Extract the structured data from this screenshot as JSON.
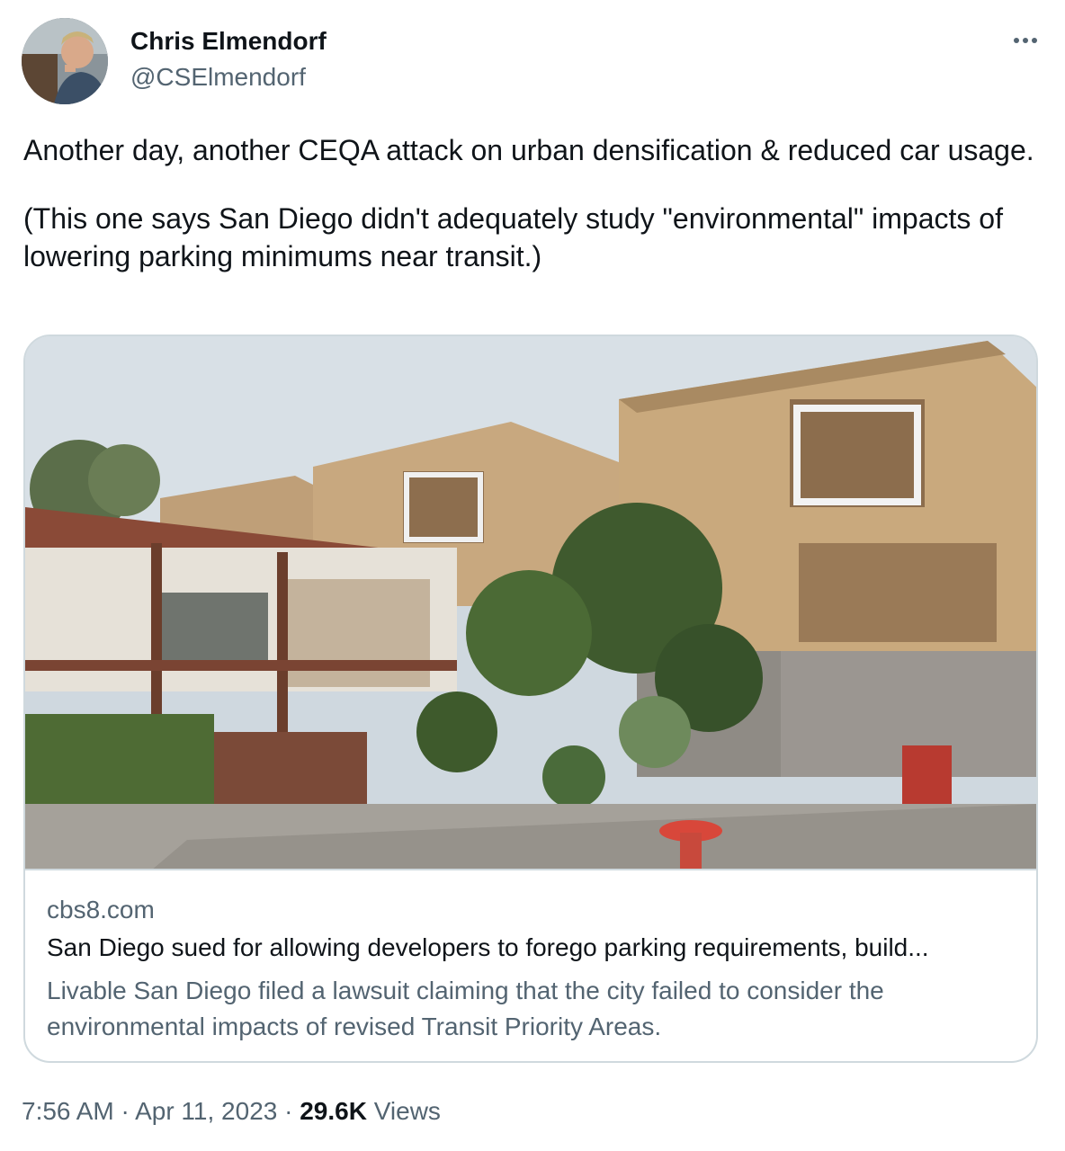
{
  "author": {
    "display_name": "Chris Elmendorf",
    "handle": "@CSElmendorf"
  },
  "tweet": {
    "paragraphs": [
      "Another day, another CEQA attack on urban densification & reduced car usage.",
      "(This one says San Diego didn't adequately study \"environmental\" impacts of lowering parking minimums near transit.)"
    ]
  },
  "card": {
    "domain": "cbs8.com",
    "title": "San Diego sued for allowing developers to forego parking requirements, build...",
    "description": "Livable San Diego filed a lawsuit claiming that the city failed to consider the environmental impacts of revised Transit Priority Areas."
  },
  "meta": {
    "time": "7:56 AM",
    "separator": "·",
    "date": "Apr 11, 2023",
    "views_count": "29.6K",
    "views_label": "Views"
  },
  "icons": {
    "more": "more-horizontal-icon"
  },
  "colors": {
    "text_primary": "#0f1419",
    "text_secondary": "#536471",
    "border": "#cfd9de"
  }
}
